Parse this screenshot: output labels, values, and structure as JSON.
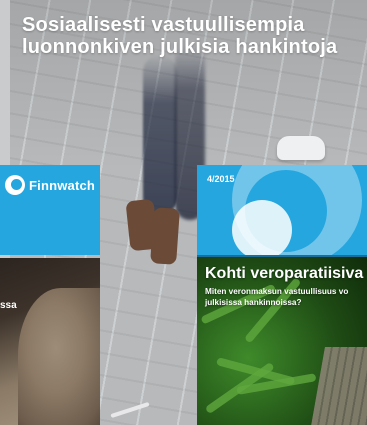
{
  "top_cover": {
    "title_lines": [
      "Sosiaalisesti vastuullisempia",
      "luonnonkiven julkisia hankintoja"
    ]
  },
  "left_cover": {
    "brand": "Finnwatch",
    "text_fragment": "ssa"
  },
  "right_cover": {
    "issue": "4/2015",
    "title": "Kohti veroparatiisiva",
    "subtitle_lines": [
      "Miten veronmaksun vastuullisuus vo",
      "julkisissa hankinnoissa?"
    ]
  },
  "colors": {
    "brand_blue": "#25a6df",
    "white": "#ffffff"
  },
  "icons": {
    "logo": "finnwatch-logo-icon"
  }
}
